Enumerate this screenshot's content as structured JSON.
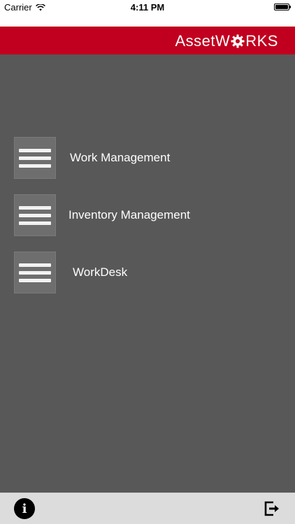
{
  "status_bar": {
    "carrier": "Carrier",
    "time": "4:11 PM"
  },
  "header": {
    "brand_prefix": "AssetW",
    "brand_suffix": "RKS",
    "accent_color": "#c1001f"
  },
  "menu": {
    "items": [
      {
        "label": "Work Management",
        "icon": "hamburger-menu-icon"
      },
      {
        "label": "Inventory Management",
        "icon": "hamburger-menu-icon"
      },
      {
        "label": "WorkDesk",
        "icon": "hamburger-menu-icon"
      }
    ]
  },
  "toolbar": {
    "info_glyph": "i",
    "info_icon": "info-icon",
    "logout_icon": "logout-icon"
  }
}
